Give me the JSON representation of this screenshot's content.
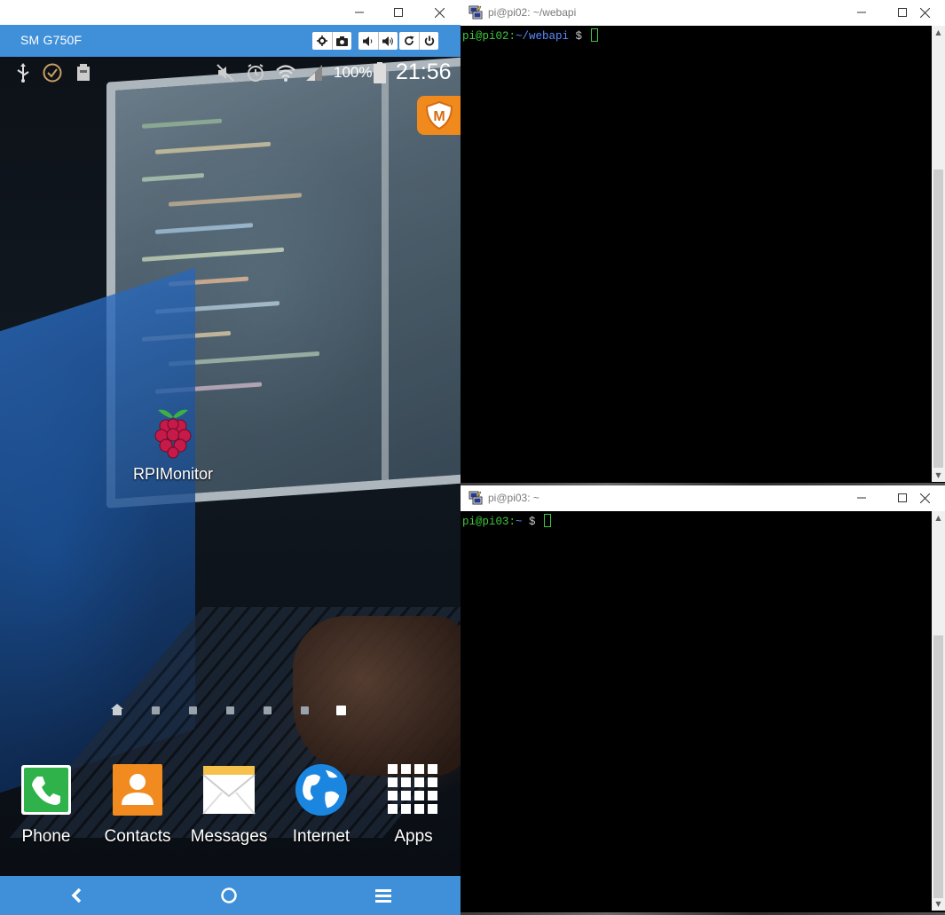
{
  "phone_window": {
    "title": "SM G750F",
    "status_bar": {
      "battery_percent": "100%",
      "time": "21:56"
    },
    "home_app": {
      "label": "RPIMonitor",
      "icon": "raspberry-pi-icon"
    },
    "page_indicator": {
      "count": 7,
      "active_index": 6,
      "home_index": 0
    },
    "dock": [
      {
        "label": "Phone",
        "icon": "phone-icon"
      },
      {
        "label": "Contacts",
        "icon": "contacts-icon"
      },
      {
        "label": "Messages",
        "icon": "messages-icon"
      },
      {
        "label": "Internet",
        "icon": "globe-icon"
      },
      {
        "label": "Apps",
        "icon": "apps-grid-icon"
      }
    ],
    "nav_bar": [
      "back-icon",
      "home-icon",
      "menu-icon"
    ],
    "accent_color": "#3f8fd9"
  },
  "terminals": [
    {
      "title": "pi@pi02: ~/webapi",
      "prompt_user": "pi@pi02",
      "prompt_sep": ":",
      "prompt_path": "~/webapi",
      "prompt_symbol": " $ "
    },
    {
      "title": "pi@pi03: ~",
      "prompt_user": "pi@pi03",
      "prompt_sep": ":",
      "prompt_path": "~",
      "prompt_symbol": " $ "
    }
  ],
  "colors": {
    "prompt_user": "#3ec83e",
    "prompt_path": "#5a8cff",
    "terminal_bg": "#000000"
  }
}
